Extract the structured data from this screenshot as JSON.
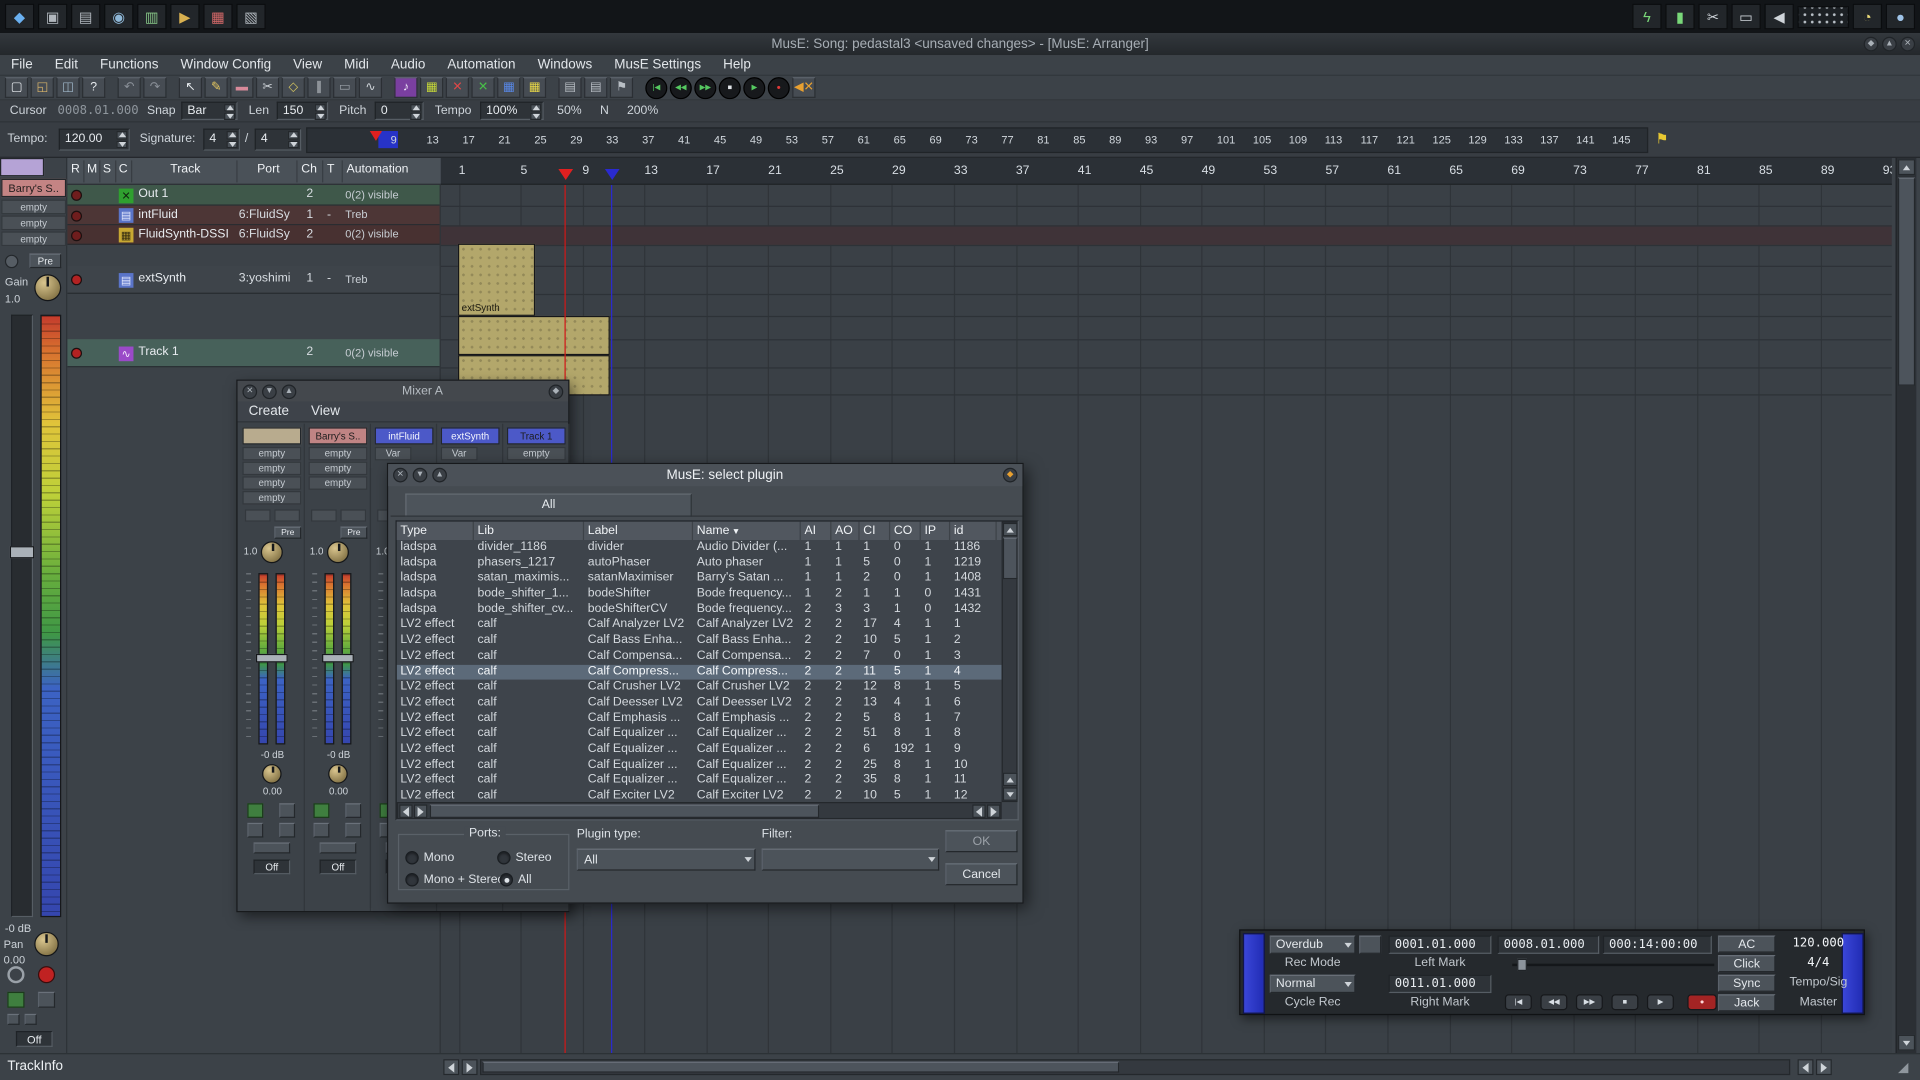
{
  "glyphs": {
    "close": "✕",
    "min": "▼",
    "max": "▲",
    "logo": "◆",
    "flag": "⚑",
    "sort": "▼",
    "power": "◎",
    "record_dot": "●",
    "grip": "◢"
  },
  "taskbar": {
    "left_icons": [
      "app-menu",
      "window-list",
      "desktop-grid",
      "screenshot-tool",
      "terminal",
      "media-player",
      "package-manager",
      "file-manager"
    ],
    "right_icons": [
      "gpu-settings",
      "battery",
      "clipper",
      "printer",
      "volume",
      "workspace-pager",
      "night-mode",
      "clock"
    ]
  },
  "window": {
    "title": "MusE: Song: pedastal3 <unsaved changes> - [MusE: Arranger]"
  },
  "menubar": [
    "File",
    "Edit",
    "Functions",
    "Window Config",
    "View",
    "Midi",
    "Audio",
    "Automation",
    "Windows",
    "MusE Settings",
    "Help"
  ],
  "toolbar": {
    "icons": [
      "new-file",
      "open-file",
      "save-file",
      "whats-this",
      "undo",
      "redo",
      "pointer-tool",
      "pencil-tool",
      "eraser-tool",
      "scissors-tool",
      "glue-tool",
      "cut-tool",
      "mute-tool",
      "zoom-tool",
      "score-editor",
      "pianoroll-editor",
      "drum-editor",
      "list-editor",
      "wave-editor",
      "cliplist-editor",
      "mixer-a-toggle",
      "mixer-b-toggle",
      "marker-view",
      "skip-start",
      "rewind",
      "fast-forward",
      "stop",
      "play",
      "record",
      "metronome-mute"
    ]
  },
  "controls_row": {
    "cursor_label": "Cursor",
    "cursor_value": "0008.01.000",
    "snap_label": "Snap",
    "snap_value": "Bar",
    "len_label": "Len",
    "len_value": "150",
    "pitch_label": "Pitch",
    "pitch_value": "0",
    "tempo_label": "Tempo",
    "tempo_value": "100%",
    "pct50": "50%",
    "n_label": "N",
    "pct200": "200%"
  },
  "tempo_row": {
    "tempo_label": "Tempo:",
    "tempo_value": "120.00",
    "sig_label": "Signature:",
    "sig_num": "4",
    "slash": "/",
    "sig_den": "4",
    "ruler": {
      "start": 9,
      "end": 149,
      "step": 4
    }
  },
  "arranger": {
    "columns": {
      "r": "R",
      "m": "M",
      "s": "S",
      "c": "C",
      "track": "Track",
      "port": "Port",
      "ch": "Ch",
      "t": "T",
      "automation": "Automation"
    },
    "ruler": {
      "start": 1,
      "end": 93,
      "step": 4
    },
    "tracks": [
      {
        "name": "Out 1",
        "port": "",
        "ch": "2",
        "t": "",
        "automation": "0(2) visible",
        "kind": "output"
      },
      {
        "name": "intFluid",
        "port": "6:FluidSy",
        "ch": "1",
        "t": "-",
        "automation": "Treb",
        "kind": "synth"
      },
      {
        "name": "FluidSynth-DSSI",
        "port": "6:FluidSy",
        "ch": "2",
        "t": "",
        "automation": "0(2) visible",
        "kind": "synth2"
      },
      {
        "name": "extSynth",
        "port": "3:yoshimi",
        "ch": "1",
        "t": "-",
        "automation": "Treb",
        "kind": "midi"
      },
      {
        "name": "Track 1",
        "port": "",
        "ch": "2",
        "t": "",
        "automation": "0(2) visible",
        "kind": "wave"
      }
    ],
    "parts": [
      {
        "label": "extSynth"
      },
      {
        "label": ""
      },
      {
        "label": ""
      }
    ]
  },
  "trackinfo": {
    "name": "Barry's S..",
    "slots": [
      "empty",
      "empty",
      "empty"
    ],
    "pre": "Pre",
    "gain_label": "Gain",
    "gain_value": "1.0",
    "db": "-0 dB",
    "pan_label": "Pan",
    "pan_value": "0.00",
    "off": "Off"
  },
  "mixer": {
    "title": "Mixer A",
    "menu": [
      "Create",
      "View"
    ],
    "strips": [
      {
        "label": "",
        "header_color": "#b8ab8e",
        "kind": "audio",
        "slots": [
          "empty",
          "empty",
          "empty",
          "empty"
        ]
      },
      {
        "label": "Barry's S..",
        "header_color": "#c08484",
        "kind": "audio",
        "slots": [
          "empty",
          "empty",
          "empty"
        ]
      },
      {
        "label": "intFluid",
        "header_color": "#4c59c8",
        "kind": "midi",
        "slots": []
      },
      {
        "label": "extSynth",
        "header_color": "#4c59c8",
        "kind": "midi",
        "slots": []
      },
      {
        "label": "Track 1",
        "header_color": "#4c59c8",
        "kind": "audio",
        "slots": [
          "empty"
        ]
      }
    ],
    "strip_misc": {
      "pre": "Pre",
      "var": "Var",
      "db": "-0 dB",
      "pan_value": "0.00",
      "off": "Off",
      "gain_value": "1.0"
    }
  },
  "plugin_dialog": {
    "title": "MusE: select plugin",
    "tab": "All",
    "columns": [
      "Type",
      "Lib",
      "Label",
      "Name",
      "AI",
      "AO",
      "CI",
      "CO",
      "IP",
      "id"
    ],
    "rows": [
      [
        "ladspa",
        "divider_1186",
        "divider",
        "Audio Divider (...",
        "1",
        "1",
        "1",
        "0",
        "1",
        "1186"
      ],
      [
        "ladspa",
        "phasers_1217",
        "autoPhaser",
        "Auto phaser",
        "1",
        "1",
        "5",
        "0",
        "1",
        "1219"
      ],
      [
        "ladspa",
        "satan_maximis...",
        "satanMaximiser",
        "Barry's Satan ...",
        "1",
        "1",
        "2",
        "0",
        "1",
        "1408"
      ],
      [
        "ladspa",
        "bode_shifter_1...",
        "bodeShifter",
        "Bode frequency...",
        "1",
        "2",
        "1",
        "1",
        "0",
        "1431"
      ],
      [
        "ladspa",
        "bode_shifter_cv...",
        "bodeShifterCV",
        "Bode frequency...",
        "2",
        "3",
        "3",
        "1",
        "0",
        "1432"
      ],
      [
        "LV2 effect",
        "calf",
        "Calf Analyzer LV2",
        "Calf Analyzer LV2",
        "2",
        "2",
        "17",
        "4",
        "1",
        "1"
      ],
      [
        "LV2 effect",
        "calf",
        "Calf Bass Enha...",
        "Calf Bass Enha...",
        "2",
        "2",
        "10",
        "5",
        "1",
        "2"
      ],
      [
        "LV2 effect",
        "calf",
        "Calf Compensa...",
        "Calf Compensa...",
        "2",
        "2",
        "7",
        "0",
        "1",
        "3"
      ],
      [
        "LV2 effect",
        "calf",
        "Calf Compress...",
        "Calf Compress...",
        "2",
        "2",
        "11",
        "5",
        "1",
        "4"
      ],
      [
        "LV2 effect",
        "calf",
        "Calf Crusher LV2",
        "Calf Crusher LV2",
        "2",
        "2",
        "12",
        "8",
        "1",
        "5"
      ],
      [
        "LV2 effect",
        "calf",
        "Calf Deesser LV2",
        "Calf Deesser LV2",
        "2",
        "2",
        "13",
        "4",
        "1",
        "6"
      ],
      [
        "LV2 effect",
        "calf",
        "Calf Emphasis ...",
        "Calf Emphasis ...",
        "2",
        "2",
        "5",
        "8",
        "1",
        "7"
      ],
      [
        "LV2 effect",
        "calf",
        "Calf Equalizer ...",
        "Calf Equalizer ...",
        "2",
        "2",
        "51",
        "8",
        "1",
        "8"
      ],
      [
        "LV2 effect",
        "calf",
        "Calf Equalizer ...",
        "Calf Equalizer ...",
        "2",
        "2",
        "6",
        "192",
        "1",
        "9"
      ],
      [
        "LV2 effect",
        "calf",
        "Calf Equalizer ...",
        "Calf Equalizer ...",
        "2",
        "2",
        "25",
        "8",
        "1",
        "10"
      ],
      [
        "LV2 effect",
        "calf",
        "Calf Equalizer ...",
        "Calf Equalizer ...",
        "2",
        "2",
        "35",
        "8",
        "1",
        "11"
      ],
      [
        "LV2 effect",
        "calf",
        "Calf Exciter LV2",
        "Calf Exciter LV2",
        "2",
        "2",
        "10",
        "5",
        "1",
        "12"
      ]
    ],
    "selected_row": 8,
    "ports_label": "Ports:",
    "radios": [
      {
        "label": "Mono",
        "checked": false
      },
      {
        "label": "Stereo",
        "checked": false
      },
      {
        "label": "Mono + Stereo",
        "checked": false
      },
      {
        "label": "All",
        "checked": true
      }
    ],
    "plugin_type_label": "Plugin type:",
    "plugin_type_value": "All",
    "filter_label": "Filter:",
    "filter_value": "",
    "ok": "OK",
    "cancel": "Cancel"
  },
  "transport": {
    "overdub": "Overdub",
    "rec_mode": "Rec Mode",
    "normal": "Normal",
    "cycle_rec": "Cycle Rec",
    "left_mark_label": "Left Mark",
    "left_mark_value": "0001.01.000",
    "right_mark_label": "Right Mark",
    "right_mark_value": "0011.01.000",
    "position_value": "0008.01.000",
    "smpte_value": "000:14:00:00",
    "ac": "AC",
    "click": "Click",
    "sync": "Sync",
    "jack": "Jack",
    "tempo_value": "120.000",
    "sig_value": "4/4",
    "tempo_sig_label": "Tempo/Sig",
    "master_label": "Master",
    "buttons": [
      "skip-start",
      "rewind",
      "fast-forward",
      "stop",
      "play",
      "record"
    ]
  },
  "statusbar": {
    "left": "TrackInfo"
  },
  "colors": {
    "part_khaki": "#b3a76b",
    "playhead_red": "#d01818",
    "locator_blue": "#2a2ad0",
    "selected_row": "#5c6a79",
    "accent_blue": "#2733c8"
  }
}
